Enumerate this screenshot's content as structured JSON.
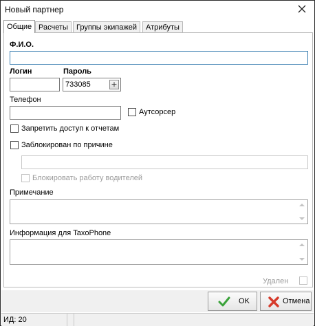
{
  "window": {
    "title": "Новый партнер"
  },
  "tabs": [
    {
      "label": "Общие"
    },
    {
      "label": "Расчеты"
    },
    {
      "label": "Группы экипажей"
    },
    {
      "label": "Атрибуты"
    }
  ],
  "form": {
    "fio_label": "Ф.И.О.",
    "fio_value": "",
    "login_label": "Логин",
    "login_value": "",
    "password_label": "Пароль",
    "password_value": "733085",
    "phone_label": "Телефон",
    "phone_value": "",
    "outsourcer_label": "Аутсорсер",
    "deny_reports_label": "Запретить доступ к отчетам",
    "blocked_reason_label": "Заблокирован по причине",
    "blocked_reason_value": "",
    "block_drivers_label": "Блокировать работу водителей",
    "note_label": "Примечание",
    "taxophone_label": "Информация для TaxoPhone",
    "deleted_label": "Удален"
  },
  "buttons": {
    "ok": "OK",
    "cancel": "Отмена"
  },
  "status": {
    "id_text": "ИД: 20"
  },
  "colors": {
    "focus_border": "#3c7fb1",
    "panel_bg": "#f0f0f0",
    "ok_icon": "#3aa23a",
    "cancel_icon": "#d63a2a"
  }
}
